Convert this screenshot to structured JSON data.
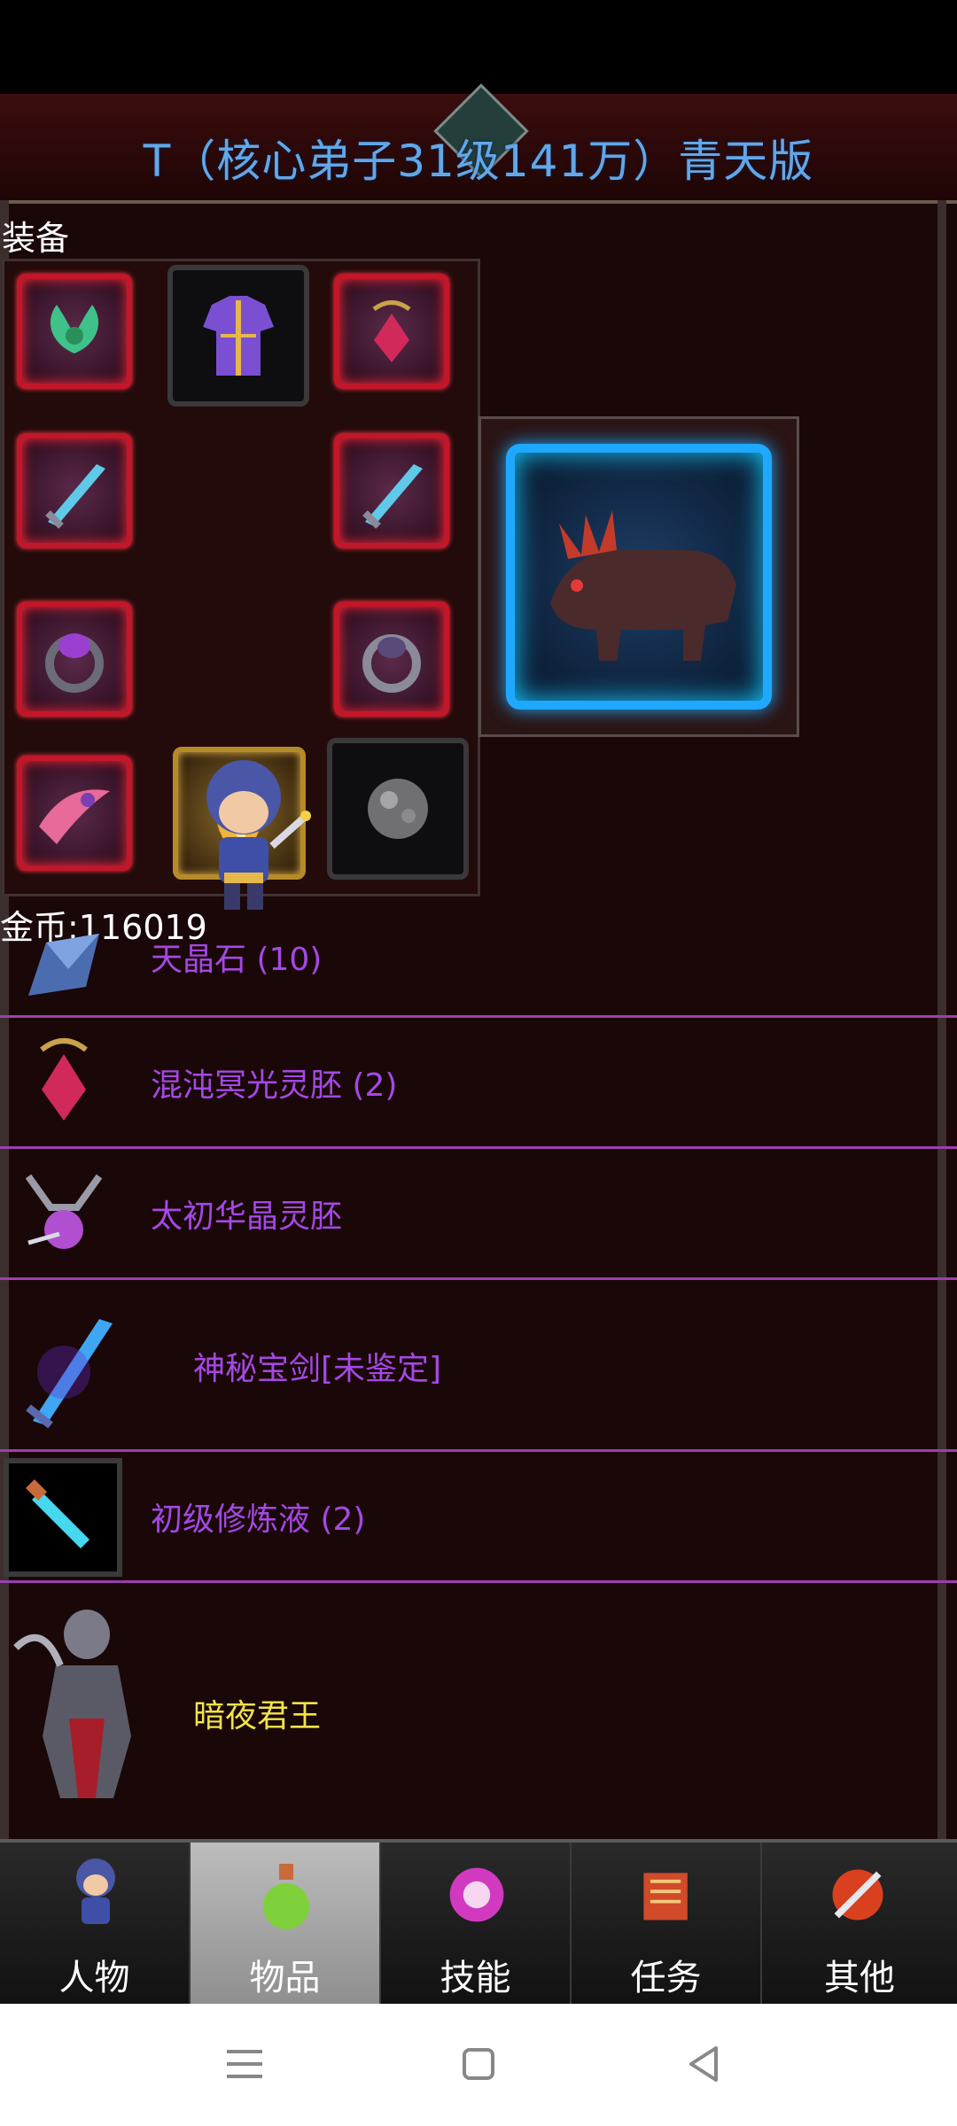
{
  "header": {
    "title": "T（核心弟子31级141万）青天版"
  },
  "equipment": {
    "label": "装备",
    "slots": [
      {
        "icon": "wing-icon"
      },
      {
        "icon": "armor-icon"
      },
      {
        "icon": "amulet-icon"
      },
      {
        "icon": "sword-icon"
      },
      {
        "icon": "sword-icon"
      },
      {
        "icon": "ring-icon"
      },
      {
        "icon": "ring-icon"
      },
      {
        "icon": "horn-icon"
      },
      {
        "icon": "flame-icon"
      },
      {
        "icon": "stone-icon"
      }
    ],
    "character": "hero-icon",
    "mount": "beast-icon"
  },
  "gold": {
    "label": "金币:116019"
  },
  "items": [
    {
      "name": "天晶石 (10)",
      "icon": "crystal-icon"
    },
    {
      "name": "混沌冥光灵胚 (2)",
      "icon": "amulet-icon"
    },
    {
      "name": "太初华晶灵胚",
      "icon": "pendant-icon"
    },
    {
      "name": "神秘宝剑[未鉴定]",
      "icon": "blue-sword-icon"
    },
    {
      "name": "初级修炼液 (2)",
      "icon": "potion-tube-icon"
    },
    {
      "name": "暗夜君王",
      "icon": "dark-king-icon"
    }
  ],
  "tabs": [
    {
      "label": "人物",
      "icon": "character-icon"
    },
    {
      "label": "物品",
      "icon": "potion-icon"
    },
    {
      "label": "技能",
      "icon": "skill-icon"
    },
    {
      "label": "任务",
      "icon": "quest-icon"
    },
    {
      "label": "其他",
      "icon": "other-icon"
    }
  ],
  "colors": {
    "item_text": "#a448e6",
    "special_item_text": "#f2e34a",
    "title_text": "#62a7e8",
    "divider": "#9b3fb0"
  }
}
